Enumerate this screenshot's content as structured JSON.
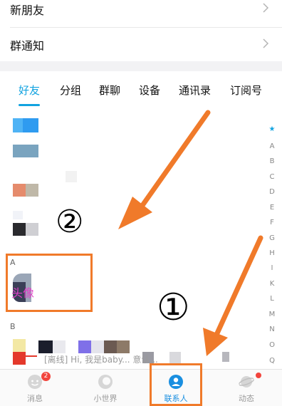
{
  "menu": {
    "new_friends": "新朋友",
    "group_notice": "群通知"
  },
  "tabs": [
    {
      "label": "好友",
      "active": true
    },
    {
      "label": "分组",
      "active": false
    },
    {
      "label": "群聊",
      "active": false
    },
    {
      "label": "设备",
      "active": false
    },
    {
      "label": "通讯录",
      "active": false
    },
    {
      "label": "订阅号",
      "active": false
    }
  ],
  "sections": {
    "a": "A",
    "b": "B"
  },
  "contact_a": {
    "avatar_text": "头像"
  },
  "index_bar": [
    "★",
    "A",
    "B",
    "C",
    "D",
    "E",
    "F",
    "G",
    "H",
    "I",
    "K",
    "L",
    "M",
    "N",
    "O",
    "Q"
  ],
  "preview_text": "[离线] Hi, 我是baby...                                  意认...",
  "annotations": {
    "circle_1": "①",
    "circle_2": "②"
  },
  "bottom_nav": [
    {
      "label": "消息",
      "badge": "2"
    },
    {
      "label": "小世界"
    },
    {
      "label": "联系人",
      "active": true
    },
    {
      "label": "动态"
    }
  ],
  "colors": {
    "accent": "#12a3e0",
    "annotation": "#f07a2a",
    "badge": "#f2453d"
  }
}
